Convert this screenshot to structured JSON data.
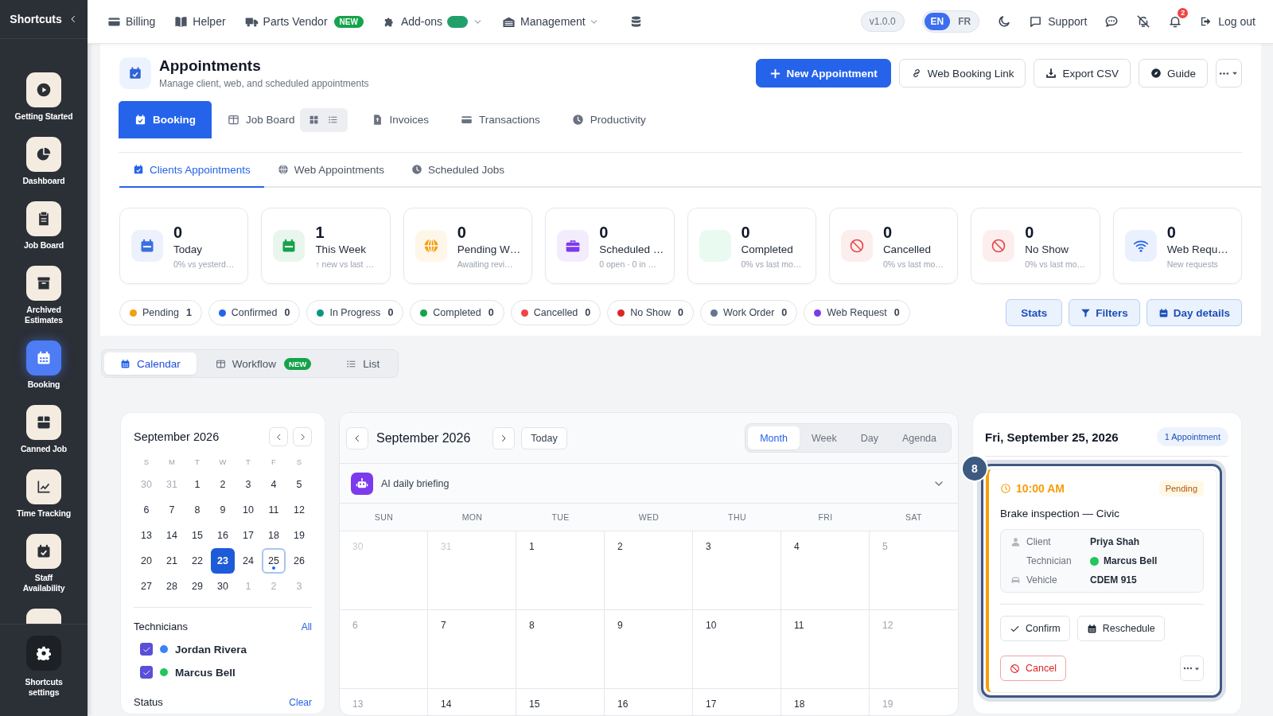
{
  "sidebar": {
    "title": "Shortcuts",
    "items": [
      {
        "label": "Getting Started",
        "selected": false
      },
      {
        "label": "Dashboard",
        "selected": false
      },
      {
        "label": "Job Board",
        "selected": false
      },
      {
        "label": "Archived Estimates",
        "selected": false
      },
      {
        "label": "Booking",
        "selected": true
      },
      {
        "label": "Canned Job",
        "selected": false
      },
      {
        "label": "Time Tracking",
        "selected": false
      },
      {
        "label": "Staff Availability",
        "selected": false
      }
    ],
    "settings": "Shortcuts settings"
  },
  "topbar": {
    "nav": [
      {
        "label": "Billing",
        "kind": "link"
      },
      {
        "label": "Helper",
        "kind": "link"
      },
      {
        "label": "Parts Vendor",
        "kind": "badge",
        "badge": "NEW"
      },
      {
        "label": "Add-ons",
        "kind": "toggle",
        "on": true
      },
      {
        "label": "Management",
        "kind": "menu"
      }
    ],
    "version": "v1.0.0",
    "languages": [
      {
        "label": "EN",
        "selected": true
      },
      {
        "label": "FR",
        "selected": false
      }
    ],
    "support": "Support",
    "notification_count": "2",
    "logout": "Log out"
  },
  "header": {
    "title": "Appointments",
    "subtitle": "Manage client, web, and scheduled appointments",
    "actions": [
      {
        "label": "New Appointment",
        "kind": "primary"
      },
      {
        "label": "Web Booking Link",
        "kind": "secondary"
      },
      {
        "label": "Export CSV",
        "kind": "secondary"
      },
      {
        "label": "Guide",
        "kind": "secondary"
      }
    ]
  },
  "main_tabs": [
    {
      "label": "Booking",
      "selected": true,
      "kind": "plain"
    },
    {
      "label": "Job Board",
      "selected": false,
      "kind": "views"
    },
    {
      "label": "Invoices",
      "selected": false,
      "kind": "plain"
    },
    {
      "label": "Transactions",
      "selected": false,
      "kind": "plain"
    },
    {
      "label": "Productivity",
      "selected": false,
      "kind": "plain"
    }
  ],
  "sub_tabs": [
    {
      "label": "Clients Appointments",
      "selected": true
    },
    {
      "label": "Web Appointments",
      "selected": false
    },
    {
      "label": "Scheduled Jobs",
      "selected": false
    }
  ],
  "stats": [
    {
      "value": "0",
      "label": "Today",
      "note": "0% vs yesterd…",
      "color": "#3b6fe0"
    },
    {
      "value": "1",
      "label": "This Week",
      "note": "↑ new vs last …",
      "color": "#16a34a"
    },
    {
      "value": "0",
      "label": "Pending W…",
      "note": "Awaiting revi…",
      "color": "#f59e0b"
    },
    {
      "value": "0",
      "label": "Scheduled …",
      "note": "0 open · 0 in …",
      "color": "#7c3aed"
    },
    {
      "value": "0",
      "label": "Completed",
      "note": "0% vs last mo…"
    },
    {
      "value": "0",
      "label": "Cancelled",
      "note": "0% vs last mo…",
      "color": "#e5484d"
    },
    {
      "value": "0",
      "label": "No Show",
      "note": "0% vs last mo…",
      "color": "#e5484d"
    },
    {
      "value": "0",
      "label": "Web Requ…",
      "note": "New requests",
      "color": "#2563eb"
    }
  ],
  "status_chips": [
    {
      "label": "Pending",
      "count": "1",
      "color": "#f59e0b"
    },
    {
      "label": "Confirmed",
      "count": "0",
      "color": "#2563eb"
    },
    {
      "label": "In Progress",
      "count": "0",
      "color": "#0d9488"
    },
    {
      "label": "Completed",
      "count": "0",
      "color": "#16a34a"
    },
    {
      "label": "Cancelled",
      "count": "0",
      "color": "#ef4444"
    },
    {
      "label": "No Show",
      "count": "0",
      "color": "#dc2626"
    },
    {
      "label": "Work Order",
      "count": "0",
      "color": "#64748b"
    },
    {
      "label": "Web Request",
      "count": "0",
      "color": "#7c3aed"
    }
  ],
  "chip_actions": [
    "Stats",
    "Filters",
    "Day details"
  ],
  "view_tabs": [
    {
      "label": "Calendar",
      "selected": true
    },
    {
      "label": "Workflow",
      "selected": false,
      "badge": "NEW"
    },
    {
      "label": "List",
      "selected": false
    }
  ],
  "mini_calendar": {
    "title": "September 2026",
    "weekdays": [
      "S",
      "M",
      "T",
      "W",
      "T",
      "F",
      "S"
    ],
    "weeks": [
      [
        {
          "day": "30",
          "muted": true,
          "selected": false,
          "marked": false
        },
        {
          "day": "31",
          "muted": true,
          "selected": false,
          "marked": false
        },
        {
          "day": "1",
          "muted": false,
          "selected": false,
          "marked": false
        },
        {
          "day": "2",
          "muted": false,
          "selected": false,
          "marked": false
        },
        {
          "day": "3",
          "muted": false,
          "selected": false,
          "marked": false
        },
        {
          "day": "4",
          "muted": false,
          "selected": false,
          "marked": false
        },
        {
          "day": "5",
          "muted": false,
          "selected": false,
          "marked": false
        }
      ],
      [
        {
          "day": "6",
          "muted": false,
          "selected": false,
          "marked": false
        },
        {
          "day": "7",
          "muted": false,
          "selected": false,
          "marked": false
        },
        {
          "day": "8",
          "muted": false,
          "selected": false,
          "marked": false
        },
        {
          "day": "9",
          "muted": false,
          "selected": false,
          "marked": false
        },
        {
          "day": "10",
          "muted": false,
          "selected": false,
          "marked": false
        },
        {
          "day": "11",
          "muted": false,
          "selected": false,
          "marked": false
        },
        {
          "day": "12",
          "muted": false,
          "selected": false,
          "marked": false
        }
      ],
      [
        {
          "day": "13",
          "muted": false,
          "selected": false,
          "marked": false
        },
        {
          "day": "14",
          "muted": false,
          "selected": false,
          "marked": false
        },
        {
          "day": "15",
          "muted": false,
          "selected": false,
          "marked": false
        },
        {
          "day": "16",
          "muted": false,
          "selected": false,
          "marked": false
        },
        {
          "day": "17",
          "muted": false,
          "selected": false,
          "marked": false
        },
        {
          "day": "18",
          "muted": false,
          "selected": false,
          "marked": false
        },
        {
          "day": "19",
          "muted": false,
          "selected": false,
          "marked": false
        }
      ],
      [
        {
          "day": "20",
          "muted": false,
          "selected": false,
          "marked": false
        },
        {
          "day": "21",
          "muted": false,
          "selected": false,
          "marked": false
        },
        {
          "day": "22",
          "muted": false,
          "selected": false,
          "marked": false
        },
        {
          "day": "23",
          "muted": false,
          "selected": true,
          "marked": false
        },
        {
          "day": "24",
          "muted": false,
          "selected": false,
          "marked": false
        },
        {
          "day": "25",
          "muted": false,
          "selected": false,
          "marked": true
        },
        {
          "day": "26",
          "muted": false,
          "selected": false,
          "marked": false
        }
      ],
      [
        {
          "day": "27",
          "muted": false,
          "selected": false,
          "marked": false
        },
        {
          "day": "28",
          "muted": false,
          "selected": false,
          "marked": false
        },
        {
          "day": "29",
          "muted": false,
          "selected": false,
          "marked": false
        },
        {
          "day": "30",
          "muted": false,
          "selected": false,
          "marked": false
        },
        {
          "day": "1",
          "muted": true,
          "selected": false,
          "marked": false
        },
        {
          "day": "2",
          "muted": true,
          "selected": false,
          "marked": false
        },
        {
          "day": "3",
          "muted": true,
          "selected": false,
          "marked": false
        }
      ]
    ],
    "technicians_title": "Technicians",
    "technicians_action": "All",
    "technicians": [
      {
        "name": "Jordan Rivera",
        "checked": true,
        "color": "#3b82f6"
      },
      {
        "name": "Marcus Bell",
        "checked": true,
        "color": "#22c55e"
      }
    ],
    "status_title": "Status",
    "status_action": "Clear"
  },
  "month_calendar": {
    "title": "September 2026",
    "today": "Today",
    "views": [
      {
        "label": "Month",
        "selected": true
      },
      {
        "label": "Week",
        "selected": false
      },
      {
        "label": "Day",
        "selected": false
      },
      {
        "label": "Agenda",
        "selected": false
      }
    ],
    "briefing": "AI daily briefing",
    "weekdays": [
      "SUN",
      "MON",
      "TUE",
      "WED",
      "THU",
      "FRI",
      "SAT"
    ],
    "weeks": [
      [
        {
          "day": "30",
          "kind": "outside"
        },
        {
          "day": "31",
          "kind": "outside"
        },
        {
          "day": "1",
          "kind": "day"
        },
        {
          "day": "2",
          "kind": "day"
        },
        {
          "day": "3",
          "kind": "day"
        },
        {
          "day": "4",
          "kind": "day"
        },
        {
          "day": "5",
          "kind": "weekend"
        }
      ],
      [
        {
          "day": "6",
          "kind": "weekend"
        },
        {
          "day": "7",
          "kind": "day"
        },
        {
          "day": "8",
          "kind": "day"
        },
        {
          "day": "9",
          "kind": "day"
        },
        {
          "day": "10",
          "kind": "day"
        },
        {
          "day": "11",
          "kind": "day"
        },
        {
          "day": "12",
          "kind": "weekend"
        }
      ],
      [
        {
          "day": "13",
          "kind": "weekend"
        },
        {
          "day": "14",
          "kind": "day"
        },
        {
          "day": "15",
          "kind": "day"
        },
        {
          "day": "16",
          "kind": "day"
        },
        {
          "day": "17",
          "kind": "day"
        },
        {
          "day": "18",
          "kind": "day"
        },
        {
          "day": "19",
          "kind": "weekend"
        }
      ]
    ]
  },
  "day_panel": {
    "title": "Fri, September 25, 2026",
    "count": "1 Appointment",
    "appointment": {
      "number": "8",
      "time": "10:00 AM",
      "status": "Pending",
      "kind": "pending",
      "title": "Brake inspection — Civic",
      "details": [
        {
          "label": "Client",
          "value": "Priya Shah"
        },
        {
          "label": "Technician",
          "value": "Marcus Bell",
          "color": "#22c55e"
        },
        {
          "label": "Vehicle",
          "value": "CDEM 915"
        }
      ],
      "actions": [
        "Confirm",
        "Reschedule"
      ],
      "cancel": "Cancel"
    }
  }
}
